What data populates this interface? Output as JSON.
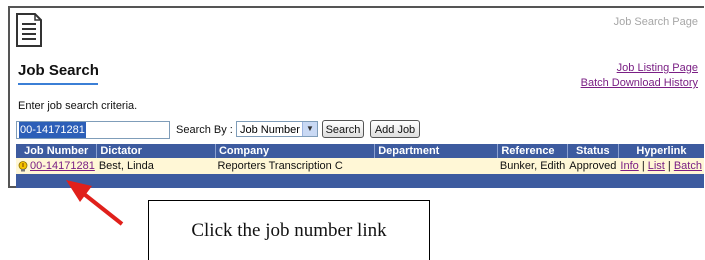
{
  "header": {
    "page_label": "Job Search Page",
    "title": "Job Search",
    "links": [
      "Job Listing Page",
      "Batch Download History"
    ]
  },
  "criteria_text": "Enter job search criteria.",
  "search": {
    "job_value": "00-14171281",
    "search_by_label": "Search By :",
    "search_by_value": "Job Number",
    "search_button": "Search",
    "add_job_button": "Add Job"
  },
  "table": {
    "columns": [
      "Job Number",
      "Dictator",
      "Company",
      "Department",
      "Reference",
      "Status",
      "Hyperlink"
    ],
    "rows": [
      {
        "job_number": "00-14171281",
        "dictator": "Best, Linda",
        "company": "Reporters Transcription C",
        "department": "",
        "reference": "Bunker, Edith",
        "status": "Approved",
        "links": [
          "Info",
          "List",
          "Batch"
        ],
        "separator": "|"
      }
    ]
  },
  "annotation": {
    "callout": "Click the job number link"
  },
  "colors": {
    "header_bg": "#3d5b9f",
    "link": "#7a1f84",
    "row_highlight": "#fff7d6",
    "arrow": "#e0201b"
  }
}
